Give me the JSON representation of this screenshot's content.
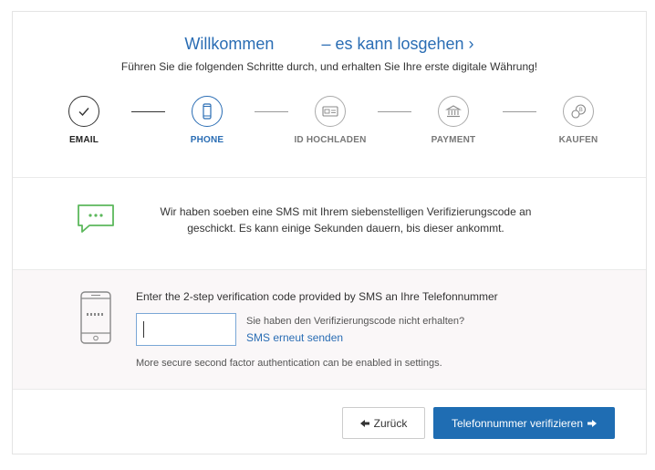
{
  "header": {
    "title_left": "Willkommen",
    "title_right": "– es kann losgehen ›",
    "subtitle": "Führen Sie die folgenden Schritte durch, und erhalten Sie Ihre erste digitale Währung!"
  },
  "steps": [
    {
      "label": "EMAIL",
      "icon": "check-icon",
      "state": "done"
    },
    {
      "label": "PHONE",
      "icon": "phone-icon",
      "state": "active"
    },
    {
      "label": "ID HOCHLADEN",
      "icon": "id-card-icon",
      "state": "pending"
    },
    {
      "label": "PAYMENT",
      "icon": "bank-icon",
      "state": "pending"
    },
    {
      "label": "KAUFEN",
      "icon": "coins-icon",
      "state": "pending"
    }
  ],
  "sms_notice": {
    "line1": "Wir haben soeben eine SMS mit Ihrem siebenstelligen Verifizierungscode an",
    "line2": "geschickt. Es kann einige Sekunden dauern, bis dieser ankommt."
  },
  "verify": {
    "label": "Enter the 2-step verification code provided by SMS an Ihre Telefonnummer",
    "code_value": "",
    "not_received": "Sie haben den Verifizierungscode nicht erhalten?",
    "resend_link": "SMS erneut senden",
    "hint": "More secure second factor authentication can be enabled in settings."
  },
  "actions": {
    "back_label": "Zurück",
    "verify_label": "Telefonnummer verifizieren"
  },
  "colors": {
    "accent": "#2a6db4",
    "primary_button": "#1f6db3",
    "sms_icon": "#5cb85c"
  }
}
